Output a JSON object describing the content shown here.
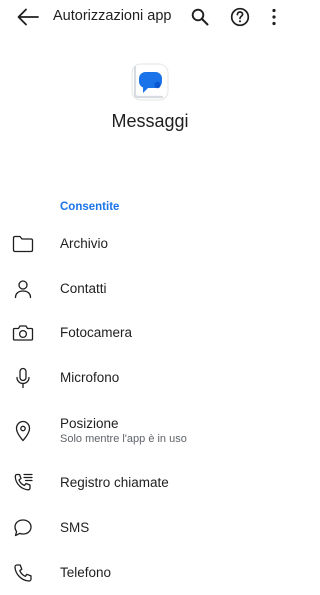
{
  "header": {
    "title": "Autorizzazioni app"
  },
  "app": {
    "name": "Messaggi"
  },
  "section": {
    "title": "Consentite"
  },
  "permissions": [
    {
      "label": "Archivio",
      "icon": "folder-icon"
    },
    {
      "label": "Contatti",
      "icon": "person-icon"
    },
    {
      "label": "Fotocamera",
      "icon": "camera-icon"
    },
    {
      "label": "Microfono",
      "icon": "microphone-icon"
    },
    {
      "label": "Posizione",
      "sublabel": "Solo mentre l'app è in uso",
      "icon": "location-pin-icon"
    },
    {
      "label": "Registro chiamate",
      "icon": "call-log-icon"
    },
    {
      "label": "SMS",
      "icon": "chat-bubble-icon"
    },
    {
      "label": "Telefono",
      "icon": "phone-icon"
    }
  ],
  "colors": {
    "accent": "#1a73e8",
    "text": "#1f1f1f",
    "secondary_text": "#5f6368"
  }
}
